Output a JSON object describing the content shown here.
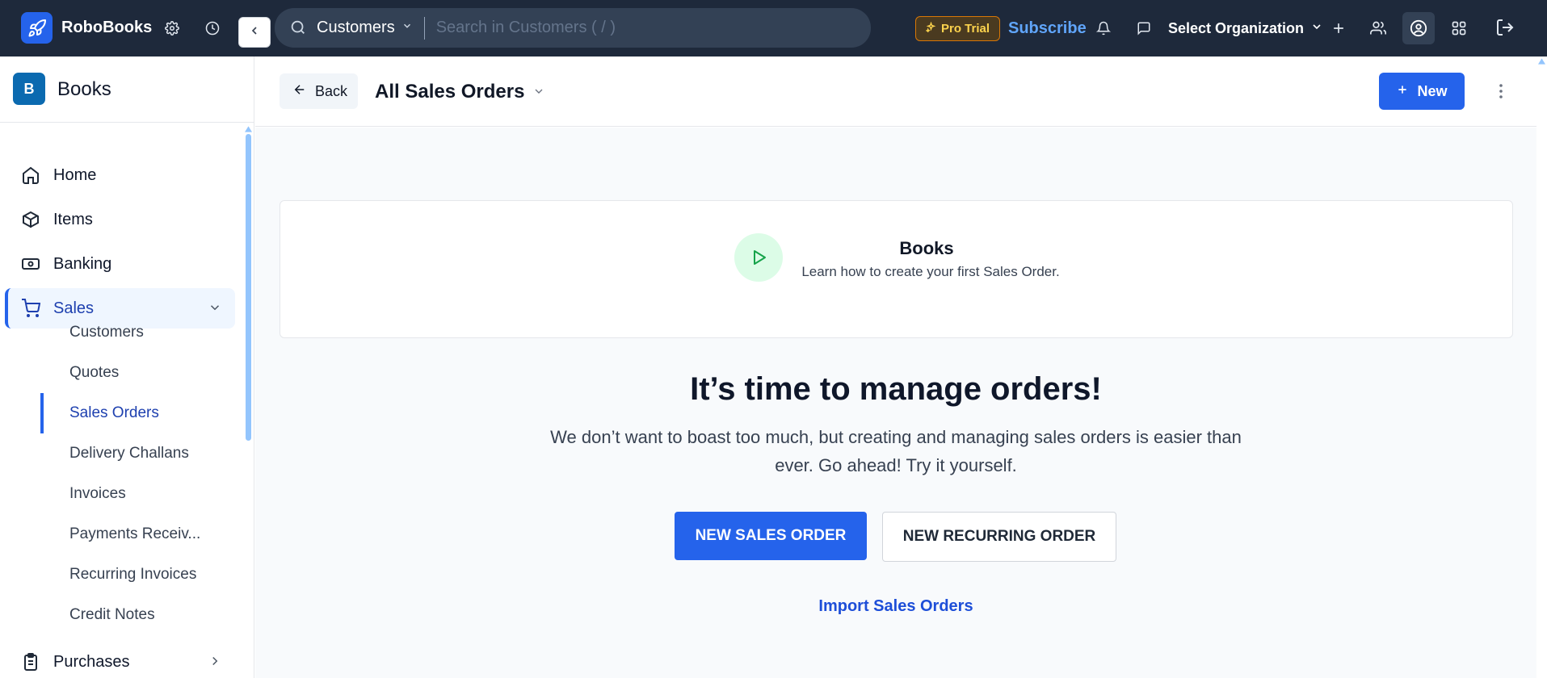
{
  "app": {
    "name": "RoboBooks"
  },
  "topbar": {
    "search_module": "Customers",
    "search_placeholder": "Search in Customers ( / )",
    "pro_trial": "Pro Trial",
    "subscribe": "Subscribe",
    "organization": "Select Organization"
  },
  "sidebar": {
    "brand_letter": "B",
    "brand_name": "Books",
    "items": [
      {
        "label": "Home",
        "icon": "home-icon"
      },
      {
        "label": "Items",
        "icon": "box-icon"
      },
      {
        "label": "Banking",
        "icon": "banknote-icon"
      },
      {
        "label": "Sales",
        "icon": "cart-icon",
        "expanded": true
      },
      {
        "label": "Purchases",
        "icon": "clipboard-icon"
      }
    ],
    "sales_subitems": [
      "Customers",
      "Quotes",
      "Sales Orders",
      "Delivery Challans",
      "Invoices",
      "Payments Receiv...",
      "Recurring Invoices",
      "Credit Notes"
    ],
    "active_subitem": "Sales Orders"
  },
  "header": {
    "back_label": "Back",
    "title": "All Sales Orders",
    "new_label": "New"
  },
  "banner": {
    "title": "Books",
    "subtitle": "Learn how to create your first Sales Order."
  },
  "hero": {
    "title": "It’s time to manage orders!",
    "text": "We don’t want to boast too much, but creating and managing sales orders is easier than ever. Go ahead! Try it yourself.",
    "primary_button": "NEW SALES ORDER",
    "secondary_button": "NEW RECURRING ORDER",
    "import_link": "Import Sales Orders"
  },
  "colors": {
    "topbar_bg": "#1e293b",
    "accent": "#2563eb",
    "subscribe": "#60a5fa",
    "pro_trial": "#fcd34d"
  }
}
